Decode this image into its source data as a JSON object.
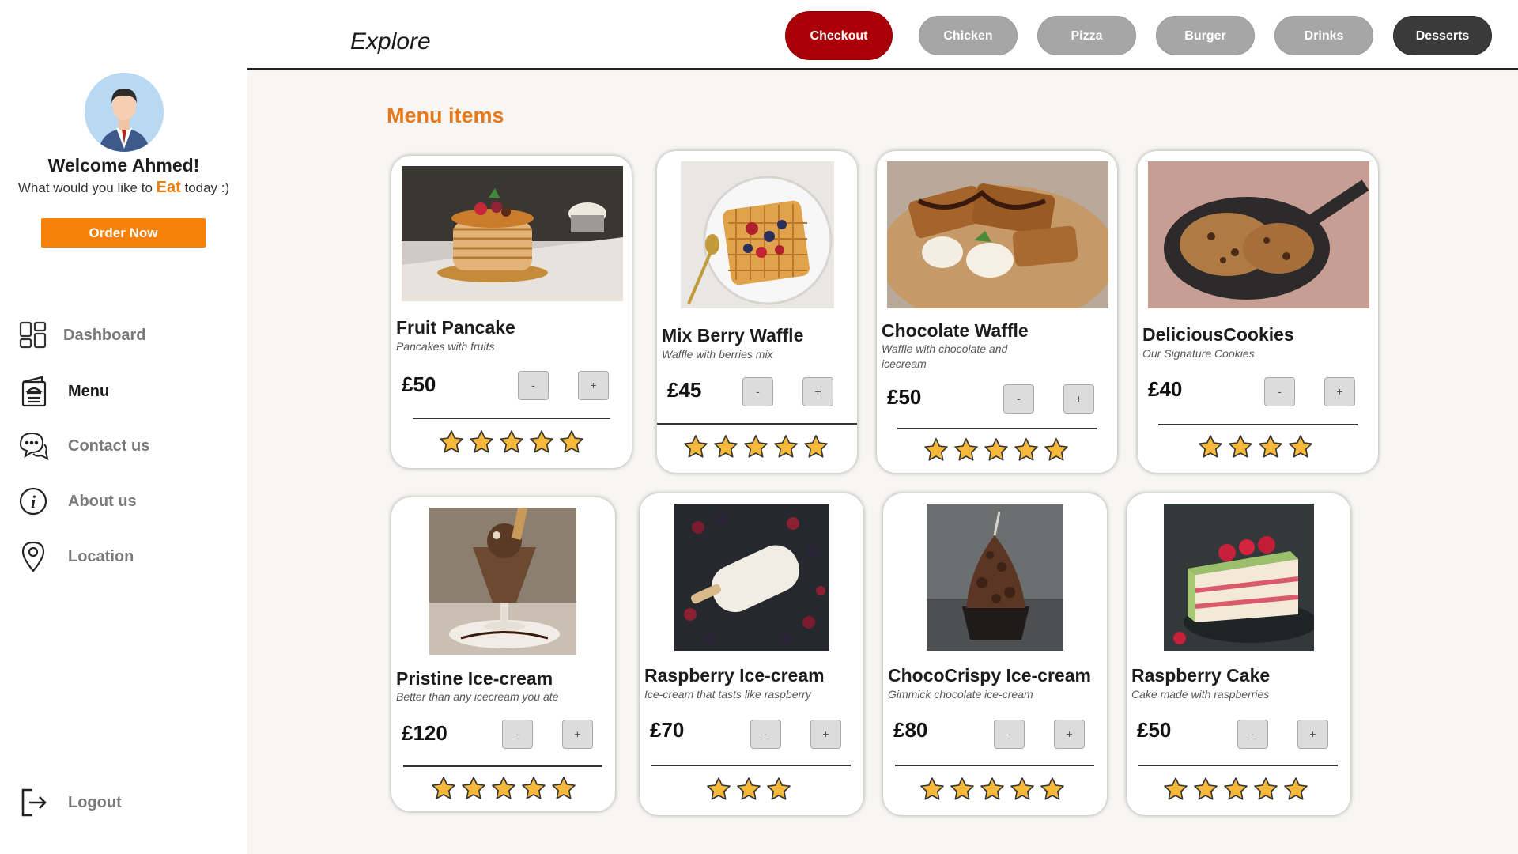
{
  "sidebar": {
    "welcome": "Welcome Ahmed!",
    "sub_before": "What would you like to ",
    "sub_eat": "Eat",
    "sub_after": " today :)",
    "order_now": "Order Now",
    "nav": [
      {
        "label": "Dashboard",
        "icon": "dashboard-icon"
      },
      {
        "label": "Menu",
        "icon": "menu-book-icon",
        "active": true
      },
      {
        "label": "Contact us",
        "icon": "chat-bubbles-icon"
      },
      {
        "label": "About us",
        "icon": "info-icon"
      },
      {
        "label": "Location",
        "icon": "location-pin-icon"
      }
    ],
    "logout": "Logout"
  },
  "header": {
    "title": "Explore",
    "tabs": [
      "Checkout",
      "Chicken",
      "Pizza",
      "Burger",
      "Drinks",
      "Desserts"
    ],
    "active_tab": "Desserts"
  },
  "main": {
    "section_title": "Menu items",
    "items": [
      {
        "name": "Fruit Pancake",
        "desc": "Pancakes with fruits",
        "price": "£50",
        "rating": 5
      },
      {
        "name": "Mix Berry Waffle",
        "desc": "Waffle with berries mix",
        "price": "£45",
        "rating": 5
      },
      {
        "name": "Chocolate Waffle",
        "desc": "Waffle with chocolate and icecream",
        "price": "£50",
        "rating": 5
      },
      {
        "name": "DeliciousCookies",
        "desc": "Our Signature Cookies",
        "price": "£40",
        "rating": 4
      },
      {
        "name": "Pristine Ice-cream",
        "desc": "Better than any icecream you ate",
        "price": "£120",
        "rating": 5
      },
      {
        "name": "Raspberry Ice-cream",
        "desc": "Ice-cream that tasts like raspberry",
        "price": "£70",
        "rating": 3
      },
      {
        "name": "ChocoCrispy Ice-cream",
        "desc": "Gimmick chocolate ice-cream",
        "price": "£80",
        "rating": 5
      },
      {
        "name": "Raspberry Cake",
        "desc": "Cake made with raspberries",
        "price": "£50",
        "rating": 5
      }
    ],
    "minus_label": "-",
    "plus_label": "+"
  },
  "colors": {
    "accent": "#f58109",
    "checkout": "#a80006",
    "active_tab": "#3a3a3a",
    "inactive_tab": "#a6a6a6",
    "star": "#f6b93b"
  }
}
